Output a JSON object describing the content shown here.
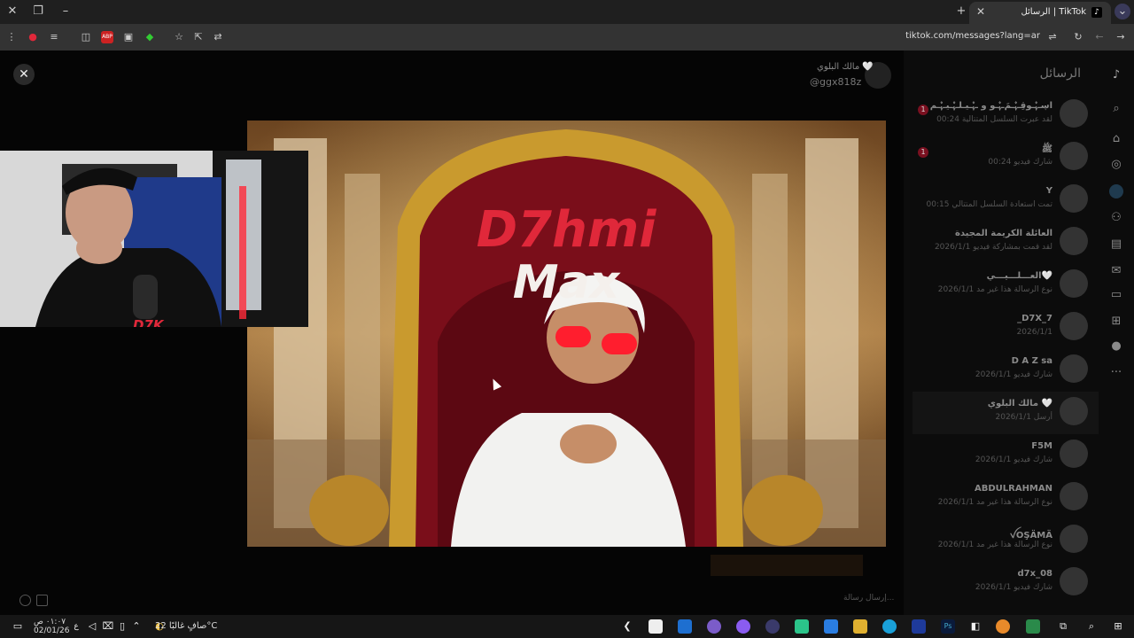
{
  "browser": {
    "tab_title": "الرسائل | TikTok",
    "url": "tiktok.com/messages?lang=ar"
  },
  "inbox": {
    "title": "الرسائل",
    "conversations": [
      {
        "name": "اڛـﮩ۫ـﻮقِـﮩ۫ـﻢَـﮩ۫ـﻮ و ـﮩ۫ـﯿـﻠـﮩ۫ـﻴـﮩ۫ـﻢ",
        "preview": "لقد عبرت السلسل المتتالية 00:24",
        "badge": "1"
      },
      {
        "name": "ﷺ",
        "preview": "شارك فيديو 00:24",
        "badge": "1"
      },
      {
        "name": "Y",
        "preview": "تمت استعادة السلسل المتتالي 00:15",
        "badge": ""
      },
      {
        "name": "العائلة الكريمة المجيدة",
        "preview": "لقد قمت بمشاركة فيديو 2026/1/1",
        "badge": ""
      },
      {
        "name": "العـ‌ــلـ‌ــيـ‌ــي🤍",
        "preview": "نوع الرسالة هذا غير مد 2026/1/1",
        "badge": ""
      },
      {
        "name": "_D7X_7",
        "preview": "2026/1/1",
        "badge": ""
      },
      {
        "name": "D A Z sa",
        "preview": "شارك فيديو 2026/1/1",
        "badge": ""
      },
      {
        "name": "مالك البلوي 🤍",
        "preview": "أرسل 2026/1/1",
        "badge": ""
      },
      {
        "name": "F5M",
        "preview": "شارك فيديو 2026/1/1",
        "badge": ""
      },
      {
        "name": "ABDULRAHMAN",
        "preview": "نوع الرسالة هذا غير مد 2026/1/1",
        "badge": ""
      },
      {
        "name": "ꪜOŞÄMÄ",
        "preview": "نوع الرسالة هذا غير مد 2026/1/1",
        "badge": ""
      },
      {
        "name": "d7x_08",
        "preview": "شارك فيديو 2026/1/1",
        "badge": ""
      }
    ]
  },
  "chat": {
    "contact_name": "مالك البلوي 🤍",
    "contact_handle": "@ggx818z",
    "input_placeholder": "إرسال رسالة..."
  },
  "image": {
    "title_line1": "D7hmi",
    "title_line2": "Max"
  },
  "webcam": {
    "logo": "D7K"
  },
  "taskbar": {
    "time": "٠١:٠٧ ص",
    "date": "02/01/26",
    "lang": "ع",
    "weather": "صافٍ غالبًا 22°C"
  },
  "colors": {
    "accent": "#e0283a",
    "background": "#050505"
  }
}
